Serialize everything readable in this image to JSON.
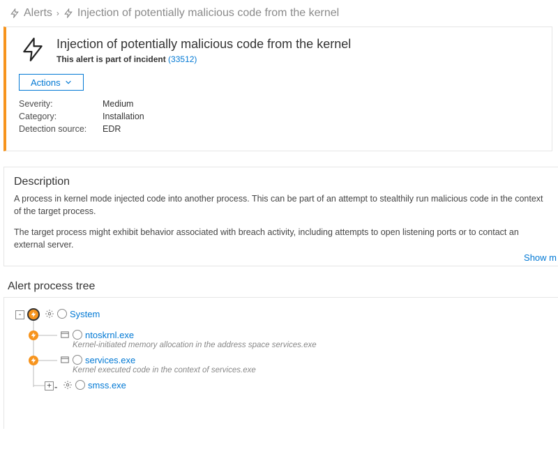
{
  "breadcrumb": {
    "root": "Alerts",
    "current": "Injection of potentially malicious code from the kernel"
  },
  "alert": {
    "title": "Injection of potentially malicious code from the kernel",
    "incident_prefix": "This alert is part of incident",
    "incident_link": "(33512)",
    "actions_label": "Actions",
    "fields": {
      "severity_key": "Severity:",
      "severity_val": "Medium",
      "category_key": "Category:",
      "category_val": "Installation",
      "detection_key": "Detection source:",
      "detection_val": "EDR"
    }
  },
  "description": {
    "heading": "Description",
    "p1": "A process in kernel mode injected code into another process. This can be part of an attempt to stealthily run malicious code in the context of the target process.",
    "p2": "The target process might exhibit behavior associated with breach activity, including attempts to open listening ports or to contact an external server.",
    "show_more": "Show m"
  },
  "tree": {
    "heading": "Alert process tree",
    "nodes": {
      "system": "System",
      "ntoskrnl": "ntoskrnl.exe",
      "ntoskrnl_sub": "Kernel-initiated memory allocation in the address space services.exe",
      "services": "services.exe",
      "services_sub": "Kernel executed code in the context of services.exe",
      "smss": "smss.exe"
    }
  }
}
